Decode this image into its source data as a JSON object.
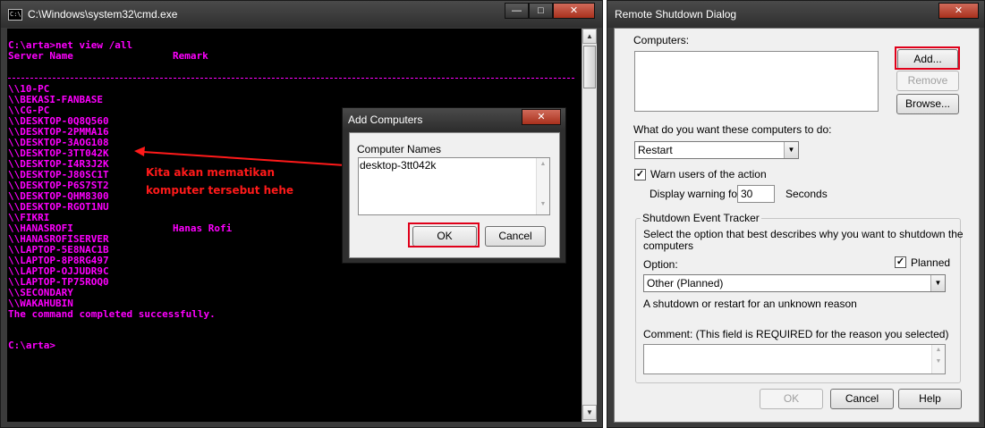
{
  "cmd": {
    "title": "C:\\Windows\\system32\\cmd.exe",
    "icon_text": "C:\\",
    "command": "C:\\arta>net view /all",
    "header_server": "Server Name",
    "header_remark": "Remark",
    "servers": [
      "\\\\10-PC",
      "\\\\BEKASI-FANBASE",
      "\\\\CG-PC",
      "\\\\DESKTOP-0Q8Q560",
      "\\\\DESKTOP-2PMMA16",
      "\\\\DESKTOP-3AOG108",
      "\\\\DESKTOP-3TT042K",
      "\\\\DESKTOP-I4R3J2K",
      "\\\\DESKTOP-J80SC1T",
      "\\\\DESKTOP-P6S7ST2",
      "\\\\DESKTOP-QHM8300",
      "\\\\DESKTOP-RGOT1NU",
      "\\\\FIKRI",
      "\\\\HANASROFI",
      "\\\\HANASROFISERVER",
      "\\\\LAPTOP-5E8NAC1B",
      "\\\\LAPTOP-8P8RG497",
      "\\\\LAPTOP-OJJUDR9C",
      "\\\\LAPTOP-TP75ROQ0",
      "\\\\SECONDARY",
      "\\\\WAKAHUBIN"
    ],
    "remark_hanasrofi": "Hanas Rofi",
    "completed": "The command completed successfully.",
    "prompt": "C:\\arta>",
    "text_color": "#ff00ff"
  },
  "annotation": {
    "line1": "Kita akan mematikan",
    "line2": "komputer tersebut hehe",
    "color": "#ff1a1a"
  },
  "add_computers": {
    "title": "Add Computers",
    "label": "Computer Names",
    "value": "desktop-3tt042k",
    "ok": "OK",
    "cancel": "Cancel"
  },
  "remote_shutdown": {
    "title": "Remote Shutdown Dialog",
    "computers_label": "Computers:",
    "add": "Add...",
    "remove": "Remove",
    "browse": "Browse...",
    "action_label": "What do you want these computers to do:",
    "action_value": "Restart",
    "warn_label": "Warn users of the action",
    "warn_checked": true,
    "display_warning": "Display warning for",
    "seconds_value": "30",
    "seconds_label": "Seconds",
    "tracker_title": "Shutdown Event Tracker",
    "tracker_desc1": "Select the option that best describes why you want to shutdown the",
    "tracker_desc2": "computers",
    "option_label": "Option:",
    "planned_label": "Planned",
    "planned_checked": true,
    "option_value": "Other (Planned)",
    "option_desc": "A shutdown or restart for an unknown reason",
    "comment_label": "Comment: (This field is REQUIRED for the reason you selected)",
    "ok": "OK",
    "cancel": "Cancel",
    "help": "Help"
  },
  "window_controls": {
    "minimize": "—",
    "maximize": "□",
    "close": "✕"
  },
  "highlight_color": "#e0001a"
}
